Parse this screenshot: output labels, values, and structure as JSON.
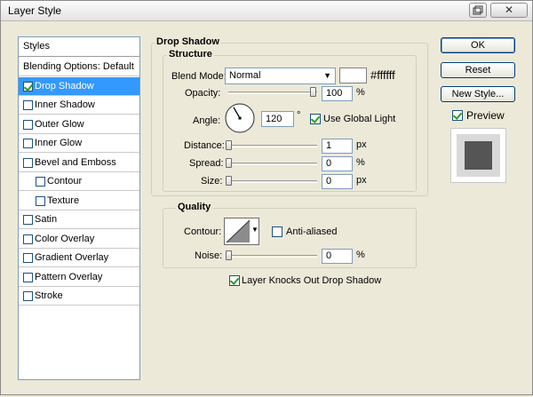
{
  "window": {
    "title": "Layer Style"
  },
  "styles_list": {
    "header": "Styles",
    "items": [
      {
        "label": "Blending Options: Default",
        "checkbox": false,
        "checked": false,
        "indent": false,
        "selected": false
      },
      {
        "label": "Drop Shadow",
        "checkbox": true,
        "checked": true,
        "indent": false,
        "selected": true
      },
      {
        "label": "Inner Shadow",
        "checkbox": true,
        "checked": false,
        "indent": false,
        "selected": false
      },
      {
        "label": "Outer Glow",
        "checkbox": true,
        "checked": false,
        "indent": false,
        "selected": false
      },
      {
        "label": "Inner Glow",
        "checkbox": true,
        "checked": false,
        "indent": false,
        "selected": false
      },
      {
        "label": "Bevel and Emboss",
        "checkbox": true,
        "checked": false,
        "indent": false,
        "selected": false
      },
      {
        "label": "Contour",
        "checkbox": true,
        "checked": false,
        "indent": true,
        "selected": false
      },
      {
        "label": "Texture",
        "checkbox": true,
        "checked": false,
        "indent": true,
        "selected": false
      },
      {
        "label": "Satin",
        "checkbox": true,
        "checked": false,
        "indent": false,
        "selected": false
      },
      {
        "label": "Color Overlay",
        "checkbox": true,
        "checked": false,
        "indent": false,
        "selected": false
      },
      {
        "label": "Gradient Overlay",
        "checkbox": true,
        "checked": false,
        "indent": false,
        "selected": false
      },
      {
        "label": "Pattern Overlay",
        "checkbox": true,
        "checked": false,
        "indent": false,
        "selected": false
      },
      {
        "label": "Stroke",
        "checkbox": true,
        "checked": false,
        "indent": false,
        "selected": false
      }
    ]
  },
  "drop_shadow": {
    "title": "Drop Shadow",
    "structure": {
      "title": "Structure",
      "blend_mode_label": "Blend Mode:",
      "blend_mode_value": "Normal",
      "color_hex": "#ffffff",
      "opacity_label": "Opacity:",
      "opacity_value": "100",
      "opacity_unit": "%",
      "opacity_level": 1.0,
      "angle_label": "Angle:",
      "angle_value": "120",
      "angle_unit": "°",
      "use_global_light_label": "Use Global Light",
      "use_global_light_checked": true,
      "distance_label": "Distance:",
      "distance_value": "1",
      "distance_unit": "px",
      "distance_level": 0.0,
      "spread_label": "Spread:",
      "spread_value": "0",
      "spread_unit": "%",
      "spread_level": 0.0,
      "size_label": "Size:",
      "size_value": "0",
      "size_unit": "px",
      "size_level": 0.0
    },
    "quality": {
      "title": "Quality",
      "contour_label": "Contour:",
      "anti_aliased_label": "Anti-aliased",
      "anti_aliased_checked": false,
      "noise_label": "Noise:",
      "noise_value": "0",
      "noise_unit": "%",
      "noise_level": 0.0
    },
    "knockout_label": "Layer Knocks Out Drop Shadow",
    "knockout_checked": true
  },
  "buttons": {
    "ok": "OK",
    "reset": "Reset",
    "new_style": "New Style..."
  },
  "preview": {
    "label": "Preview",
    "checked": true
  },
  "colors": {
    "selection": "#3399ff",
    "window": "#ece9d8",
    "preview_swatch": "#555555"
  }
}
